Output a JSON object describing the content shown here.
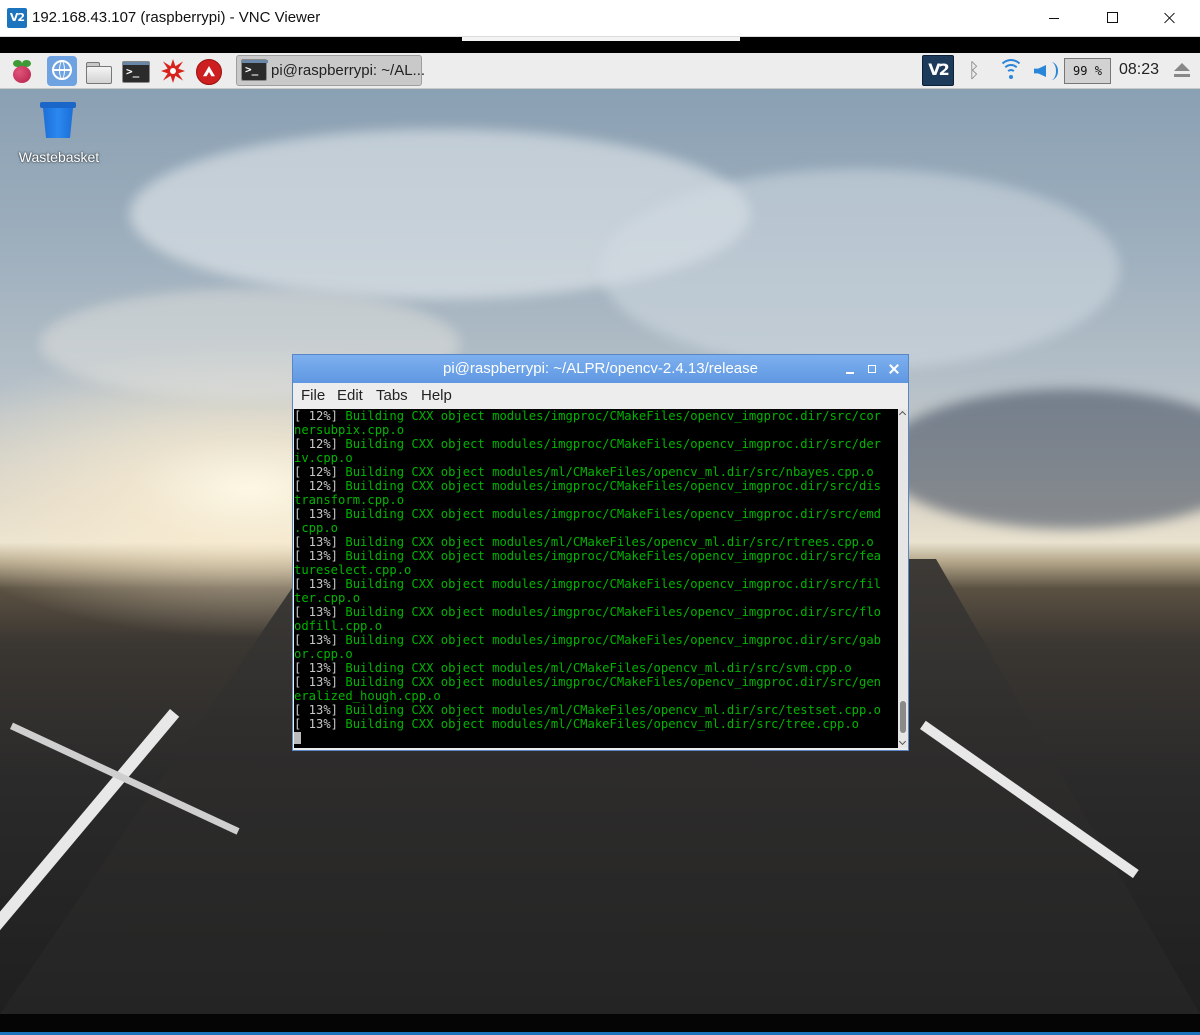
{
  "window": {
    "app_icon": "vnc-viewer-icon",
    "app_logo_text": "V2",
    "title": "192.168.43.107 (raspberrypi) - VNC Viewer"
  },
  "panel": {
    "launchers": [
      {
        "name": "raspberry-menu-icon"
      },
      {
        "name": "web-browser-icon",
        "active": true
      },
      {
        "name": "file-manager-icon"
      },
      {
        "name": "terminal-icon"
      },
      {
        "name": "mathematica-icon"
      },
      {
        "name": "wolfram-icon"
      }
    ],
    "terminal_glyph": ">_",
    "taskbar_item": {
      "label": "pi@raspberrypi: ~/AL..."
    },
    "tray": {
      "vnc_logo_text": "V2",
      "cpu_usage": "99 %",
      "clock": "08:23"
    }
  },
  "desktop": {
    "icons": [
      {
        "label": "Wastebasket",
        "icon": "wastebasket-icon"
      }
    ]
  },
  "terminal": {
    "title": "pi@raspberrypi: ~/ALPR/opencv-2.4.13/release",
    "menu": [
      "File",
      "Edit",
      "Tabs",
      "Help"
    ],
    "lines": [
      {
        "pre": "[ 12%] ",
        "text": "Building CXX object modules/imgproc/CMakeFiles/opencv_imgproc.dir/src/cor"
      },
      {
        "pre": "",
        "text": "nersubpix.cpp.o"
      },
      {
        "pre": "[ 12%] ",
        "text": "Building CXX object modules/imgproc/CMakeFiles/opencv_imgproc.dir/src/der"
      },
      {
        "pre": "",
        "text": "iv.cpp.o"
      },
      {
        "pre": "[ 12%] ",
        "text": "Building CXX object modules/ml/CMakeFiles/opencv_ml.dir/src/nbayes.cpp.o"
      },
      {
        "pre": "[ 12%] ",
        "text": "Building CXX object modules/imgproc/CMakeFiles/opencv_imgproc.dir/src/dis"
      },
      {
        "pre": "",
        "text": "transform.cpp.o"
      },
      {
        "pre": "[ 13%] ",
        "text": "Building CXX object modules/imgproc/CMakeFiles/opencv_imgproc.dir/src/emd"
      },
      {
        "pre": "",
        "text": ".cpp.o"
      },
      {
        "pre": "[ 13%] ",
        "text": "Building CXX object modules/ml/CMakeFiles/opencv_ml.dir/src/rtrees.cpp.o"
      },
      {
        "pre": "[ 13%] ",
        "text": "Building CXX object modules/imgproc/CMakeFiles/opencv_imgproc.dir/src/fea"
      },
      {
        "pre": "",
        "text": "tureselect.cpp.o"
      },
      {
        "pre": "[ 13%] ",
        "text": "Building CXX object modules/imgproc/CMakeFiles/opencv_imgproc.dir/src/fil"
      },
      {
        "pre": "",
        "text": "ter.cpp.o"
      },
      {
        "pre": "[ 13%] ",
        "text": "Building CXX object modules/imgproc/CMakeFiles/opencv_imgproc.dir/src/flo"
      },
      {
        "pre": "",
        "text": "odfill.cpp.o"
      },
      {
        "pre": "[ 13%] ",
        "text": "Building CXX object modules/imgproc/CMakeFiles/opencv_imgproc.dir/src/gab"
      },
      {
        "pre": "",
        "text": "or.cpp.o"
      },
      {
        "pre": "[ 13%] ",
        "text": "Building CXX object modules/ml/CMakeFiles/opencv_ml.dir/src/svm.cpp.o"
      },
      {
        "pre": "[ 13%] ",
        "text": "Building CXX object modules/imgproc/CMakeFiles/opencv_imgproc.dir/src/gen"
      },
      {
        "pre": "",
        "text": "eralized_hough.cpp.o"
      },
      {
        "pre": "[ 13%] ",
        "text": "Building CXX object modules/ml/CMakeFiles/opencv_ml.dir/src/testset.cpp.o"
      },
      {
        "pre": "[ 13%] ",
        "text": "Building CXX object modules/ml/CMakeFiles/opencv_ml.dir/src/tree.cpp.o"
      }
    ],
    "text_color": "#00b400",
    "background_color": "#000000"
  }
}
